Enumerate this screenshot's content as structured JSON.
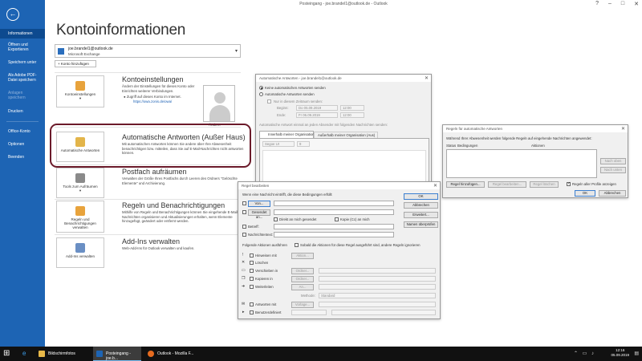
{
  "window": {
    "title": "Posteingang - joe.brandel1@outlook.de - Outlook",
    "controls": [
      "?",
      "–",
      "□",
      "✕"
    ]
  },
  "sidebar": {
    "back_icon": "arrow-left-icon",
    "items": [
      {
        "label": "Informationen"
      },
      {
        "label": "Öffnen und Exportieren"
      },
      {
        "label": "Speichern unter"
      },
      {
        "label": "Als Adobe PDF-Datei speichern"
      },
      {
        "label": "Anlagen speichern"
      },
      {
        "label": "Drucken"
      },
      {
        "label": "Office-Konto"
      },
      {
        "label": "Optionen"
      },
      {
        "label": "Beenden"
      }
    ]
  },
  "main": {
    "title": "Kontoinformationen",
    "account": {
      "email": "joe.brandel1@outlook.de",
      "type": "Microsoft Exchange"
    },
    "add_account": "+ Konto hinzufügen",
    "sections": {
      "settings": {
        "tile": "Kontoeinstellungen",
        "tile_arrow": "▾",
        "title": "Kontoeinstellungen",
        "desc": "Ändern der Einstellungen für dieses Konto oder Einrichten weiterer Verbindungen.",
        "bullet": "Zugriff auf dieses Konto im Internet.",
        "link": "https://owa.zonis.de/owa/"
      },
      "photo_label": "Ändern",
      "auto": {
        "tile": "Automatische Antworten",
        "title": "Automatische Antworten (Außer Haus)",
        "desc": "Mit automatischen Antworten können Sie andere über Ihre Abwesenheit benachrichtigen bzw. mitteilen, dass Sie auf E-Mail-Nachrichten nicht antworten können."
      },
      "cleanup": {
        "tile": "Tools zum Aufräumen",
        "tile_arrow": "▾",
        "title": "Postfach aufräumen",
        "desc": "Verwalten der Größe Ihres Postfachs durch Leeren des Ordners \"Gelöschte Elemente\" und Archivierung."
      },
      "rules": {
        "tile": "Regeln und Benachrichtigungen verwalten",
        "title": "Regeln und Benachrichtigungen",
        "desc": "Mithilfe von Regeln und Benachrichtigungen können Sie eingehende E-Mail-Nachrichten organisieren und Aktualisierungen erhalten, wenn Elemente hinzugefügt, geändert oder entfernt werden."
      },
      "addins": {
        "tile": "Add-Ins verwalten",
        "title": "Add-Ins verwalten",
        "desc": "Web-Add-Ins für Outlook verwalten und kaufen."
      }
    }
  },
  "auto_dialog": {
    "title": "Automatische Antworten - joe.brandel1@outlook.de",
    "opt_off": "Keine automatischen Antworten senden",
    "opt_on": "Automatische Antworten senden",
    "range": "Nur in diesem Zeitraum senden:",
    "start_label": "Beginn:",
    "start_date": "Do 05.09.2019",
    "start_time": "12:00",
    "end_label": "Ende:",
    "end_date": "Fr 06.09.2019",
    "end_time": "12:00",
    "hint": "Automatische Antwort einmal an jeden Absender mit folgenden Nachrichten senden:",
    "tab_in": "Innerhalb meiner Organisation",
    "tab_out": "Außerhalb meiner Organisation (Aus)",
    "font": "Segoe UI",
    "size": "9"
  },
  "rules_dialog": {
    "title": "Regeln für automatische Antworten",
    "desc": "Während Ihrer Abwesenheit werden folgende Regeln auf eingehende Nachrichten angewendet:",
    "cols": [
      "Status",
      "Bedingungen",
      "Aktionen"
    ],
    "up": "Nach oben",
    "down": "Nach unten",
    "add": "Regel hinzufügen...",
    "edit": "Regel bearbeiten...",
    "delete": "Regel löschen",
    "profiles": "Regeln aller Profile anzeigen",
    "ok": "OK",
    "cancel": "Abbrechen"
  },
  "edit_dialog": {
    "title": "Regel bearbeiten",
    "cond_hint": "Wenn eine Nachricht eintrifft, die diese Bedingungen erfüllt",
    "from": "Von...",
    "sent_to": "Gesendet an...",
    "direct": "Direkt an mich gesendet",
    "cc": "Kopie (Cc) an mich",
    "subject": "Betreff:",
    "body": "Nachrichtentext:",
    "ok": "OK",
    "cancel": "Abbrechen",
    "advanced": "Erweitert...",
    "check_names": "Namen überprüfen",
    "actions_hint": "Folgende Aktionen ausführen",
    "stop": "Sobald die Aktionen für diese Regel ausgeführt sind, andere Regeln ignorieren",
    "actions": {
      "alert": {
        "label": "Hinweisen mit",
        "btn": "Aktion..."
      },
      "delete": {
        "label": "Löschen"
      },
      "move": {
        "label": "Verschieben in",
        "btn": "Ordner..."
      },
      "copy": {
        "label": "Kopieren in",
        "btn": "Ordner..."
      },
      "forward": {
        "label": "Weiterleiten",
        "btn": "An..."
      },
      "method_label": "Methode:",
      "method_value": "Standard",
      "reply": {
        "label": "Antworten mit",
        "btn": "Vorlage..."
      },
      "custom": {
        "label": "Benutzerdefiniert"
      }
    }
  },
  "taskbar": {
    "items": [
      {
        "label": "Bildschirmfotos"
      },
      {
        "label": "Posteingang - joe.b..."
      },
      {
        "label": "Outlook - Mozilla F..."
      }
    ],
    "time": "12:16",
    "date": "05.09.2019",
    "colors": {
      "accent": "#1d64b4",
      "highlight": "#6b1a2a"
    }
  }
}
